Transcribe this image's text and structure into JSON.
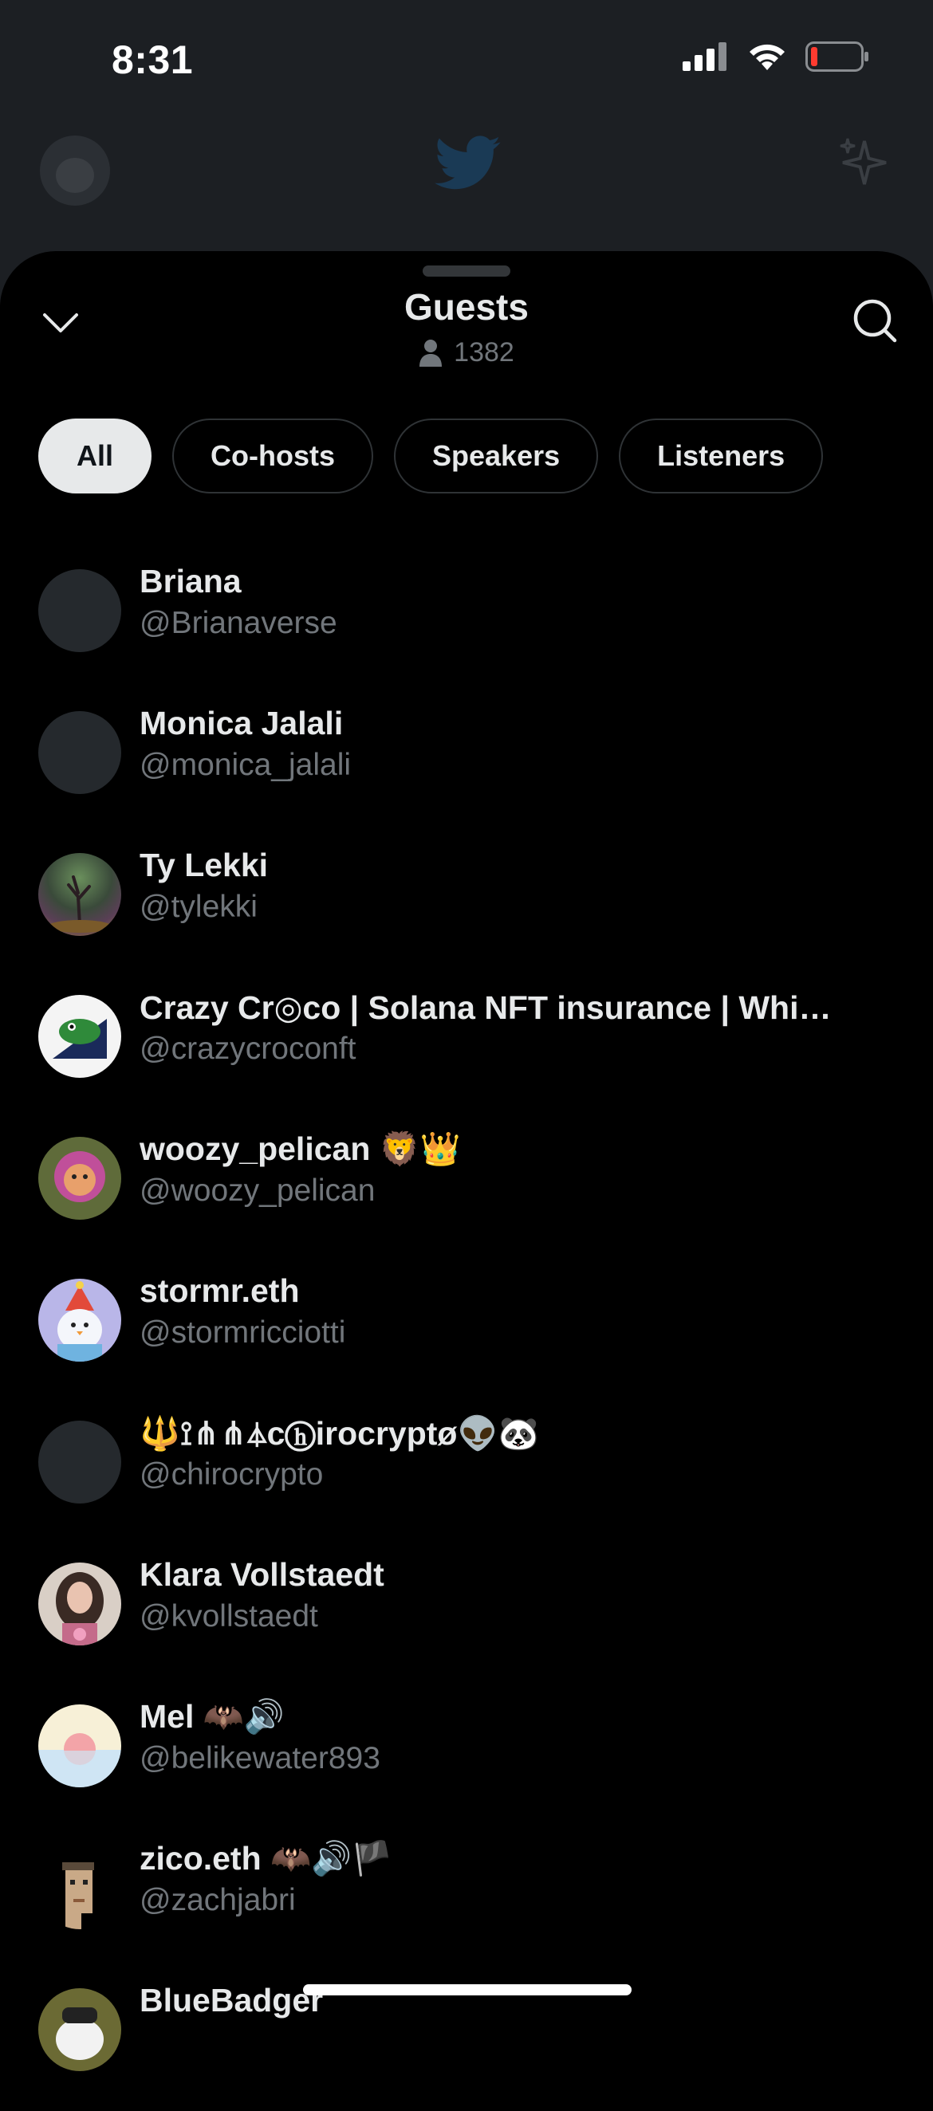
{
  "status_bar": {
    "time": "8:31"
  },
  "sheet": {
    "title": "Guests",
    "guest_count": "1382"
  },
  "filters": [
    {
      "label": "All",
      "active": true
    },
    {
      "label": "Co-hosts",
      "active": false
    },
    {
      "label": "Speakers",
      "active": false
    },
    {
      "label": "Listeners",
      "active": false
    }
  ],
  "guests": [
    {
      "name": "Briana",
      "handle": "@Brianaverse"
    },
    {
      "name": "Monica Jalali",
      "handle": "@monica_jalali"
    },
    {
      "name": "Ty Lekki",
      "handle": "@tylekki"
    },
    {
      "name": "Crazy Cr◎co | Solana NFT insurance | Whi…",
      "handle": "@crazycroconft"
    },
    {
      "name": "woozy_pelican 🦁👑",
      "handle": "@woozy_pelican"
    },
    {
      "name": "stormr.eth",
      "handle": "@stormricciotti"
    },
    {
      "name": "🔱⟟⋔⋔⏃cⓗirocryptø👽🐼",
      "handle": "@chirocrypto"
    },
    {
      "name": "Klara Vollstaedt",
      "handle": "@kvollstaedt"
    },
    {
      "name": "Mel 🦇🔊",
      "handle": "@belikewater893"
    },
    {
      "name": "zico.eth 🦇🔊🏴",
      "handle": "@zachjabri"
    },
    {
      "name": "BlueBadger",
      "handle": ""
    }
  ],
  "colors": {
    "background": "#000000",
    "text_primary": "#e7e9ea",
    "text_secondary": "#71767b",
    "chip_border": "#2f3336"
  }
}
